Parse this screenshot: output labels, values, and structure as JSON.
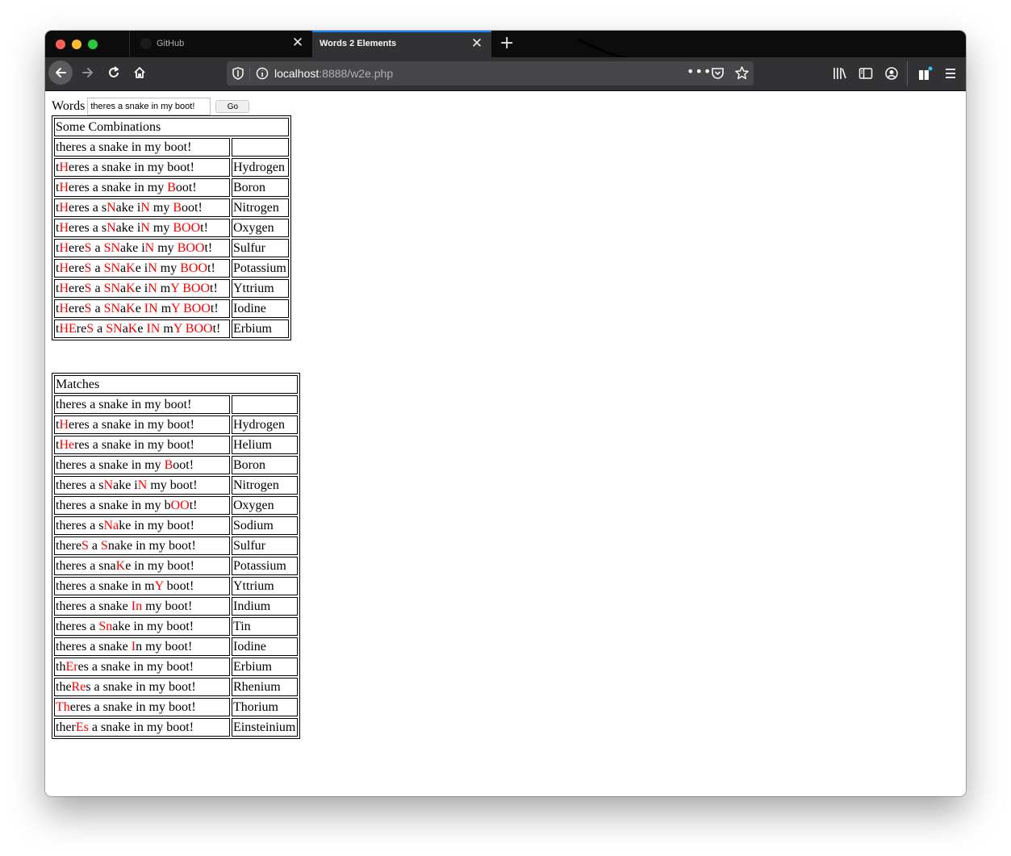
{
  "browser": {
    "tabs": [
      {
        "label": "GitHub",
        "active": false
      },
      {
        "label": "Words 2 Elements",
        "active": true
      }
    ],
    "url_host": "localhost",
    "url_rest": ":8888/w2e.php"
  },
  "form": {
    "label": "Words",
    "input_value": "theres a snake in my boot!",
    "button_label": "Go"
  },
  "colors": {
    "highlight": "#ff0000",
    "tab_accent": "#0a84ff"
  },
  "combinations": {
    "title": "Some Combinations",
    "rows": [
      {
        "segments": [
          [
            "theres a snake in my boot!",
            0
          ]
        ],
        "element": ""
      },
      {
        "segments": [
          [
            "t",
            0
          ],
          [
            "H",
            1
          ],
          [
            "eres a snake in my boot!",
            0
          ]
        ],
        "element": "Hydrogen"
      },
      {
        "segments": [
          [
            "t",
            0
          ],
          [
            "H",
            1
          ],
          [
            "eres a snake in my ",
            0
          ],
          [
            "B",
            1
          ],
          [
            "oot!",
            0
          ]
        ],
        "element": "Boron"
      },
      {
        "segments": [
          [
            "t",
            0
          ],
          [
            "H",
            1
          ],
          [
            "eres a s",
            0
          ],
          [
            "N",
            1
          ],
          [
            "ake i",
            0
          ],
          [
            "N",
            1
          ],
          [
            " my ",
            0
          ],
          [
            "B",
            1
          ],
          [
            "oot!",
            0
          ]
        ],
        "element": "Nitrogen"
      },
      {
        "segments": [
          [
            "t",
            0
          ],
          [
            "H",
            1
          ],
          [
            "eres a s",
            0
          ],
          [
            "N",
            1
          ],
          [
            "ake i",
            0
          ],
          [
            "N",
            1
          ],
          [
            " my ",
            0
          ],
          [
            "BOO",
            1
          ],
          [
            "t!",
            0
          ]
        ],
        "element": "Oxygen"
      },
      {
        "segments": [
          [
            "t",
            0
          ],
          [
            "H",
            1
          ],
          [
            "ere",
            0
          ],
          [
            "S",
            1
          ],
          [
            " a ",
            0
          ],
          [
            "SN",
            1
          ],
          [
            "ake i",
            0
          ],
          [
            "N",
            1
          ],
          [
            " my ",
            0
          ],
          [
            "BOO",
            1
          ],
          [
            "t!",
            0
          ]
        ],
        "element": "Sulfur"
      },
      {
        "segments": [
          [
            "t",
            0
          ],
          [
            "H",
            1
          ],
          [
            "ere",
            0
          ],
          [
            "S",
            1
          ],
          [
            " a ",
            0
          ],
          [
            "SN",
            1
          ],
          [
            "a",
            0
          ],
          [
            "K",
            1
          ],
          [
            "e i",
            0
          ],
          [
            "N",
            1
          ],
          [
            " my ",
            0
          ],
          [
            "BOO",
            1
          ],
          [
            "t!",
            0
          ]
        ],
        "element": "Potassium"
      },
      {
        "segments": [
          [
            "t",
            0
          ],
          [
            "H",
            1
          ],
          [
            "ere",
            0
          ],
          [
            "S",
            1
          ],
          [
            " a ",
            0
          ],
          [
            "SN",
            1
          ],
          [
            "a",
            0
          ],
          [
            "K",
            1
          ],
          [
            "e i",
            0
          ],
          [
            "N",
            1
          ],
          [
            " m",
            0
          ],
          [
            "Y",
            1
          ],
          [
            " ",
            0
          ],
          [
            "BOO",
            1
          ],
          [
            "t!",
            0
          ]
        ],
        "element": "Yttrium"
      },
      {
        "segments": [
          [
            "t",
            0
          ],
          [
            "H",
            1
          ],
          [
            "ere",
            0
          ],
          [
            "S",
            1
          ],
          [
            " a ",
            0
          ],
          [
            "SN",
            1
          ],
          [
            "a",
            0
          ],
          [
            "K",
            1
          ],
          [
            "e ",
            0
          ],
          [
            "IN",
            1
          ],
          [
            " m",
            0
          ],
          [
            "Y",
            1
          ],
          [
            " ",
            0
          ],
          [
            "BOO",
            1
          ],
          [
            "t!",
            0
          ]
        ],
        "element": "Iodine"
      },
      {
        "segments": [
          [
            "t",
            0
          ],
          [
            "HE",
            1
          ],
          [
            "re",
            0
          ],
          [
            "S",
            1
          ],
          [
            " a ",
            0
          ],
          [
            "SN",
            1
          ],
          [
            "a",
            0
          ],
          [
            "K",
            1
          ],
          [
            "e ",
            0
          ],
          [
            "IN",
            1
          ],
          [
            " m",
            0
          ],
          [
            "Y",
            1
          ],
          [
            " ",
            0
          ],
          [
            "BOO",
            1
          ],
          [
            "t!",
            0
          ]
        ],
        "element": "Erbium"
      }
    ]
  },
  "matches": {
    "title": "Matches",
    "rows": [
      {
        "segments": [
          [
            "theres a snake in my boot!",
            0
          ]
        ],
        "element": ""
      },
      {
        "segments": [
          [
            "t",
            0
          ],
          [
            "H",
            1
          ],
          [
            "eres a snake in my boot!",
            0
          ]
        ],
        "element": "Hydrogen"
      },
      {
        "segments": [
          [
            "t",
            0
          ],
          [
            "He",
            1
          ],
          [
            "res a snake in my boot!",
            0
          ]
        ],
        "element": "Helium"
      },
      {
        "segments": [
          [
            "theres a snake in my ",
            0
          ],
          [
            "B",
            1
          ],
          [
            "oot!",
            0
          ]
        ],
        "element": "Boron"
      },
      {
        "segments": [
          [
            "theres a s",
            0
          ],
          [
            "N",
            1
          ],
          [
            "ake i",
            0
          ],
          [
            "N",
            1
          ],
          [
            " my boot!",
            0
          ]
        ],
        "element": "Nitrogen"
      },
      {
        "segments": [
          [
            "theres a snake in my b",
            0
          ],
          [
            "OO",
            1
          ],
          [
            "t!",
            0
          ]
        ],
        "element": "Oxygen"
      },
      {
        "segments": [
          [
            "theres a s",
            0
          ],
          [
            "Na",
            1
          ],
          [
            "ke in my boot!",
            0
          ]
        ],
        "element": "Sodium"
      },
      {
        "segments": [
          [
            "there",
            0
          ],
          [
            "S",
            1
          ],
          [
            " a ",
            0
          ],
          [
            "S",
            1
          ],
          [
            "nake in my boot!",
            0
          ]
        ],
        "element": "Sulfur"
      },
      {
        "segments": [
          [
            "theres a sna",
            0
          ],
          [
            "K",
            1
          ],
          [
            "e in my boot!",
            0
          ]
        ],
        "element": "Potassium"
      },
      {
        "segments": [
          [
            "theres a snake in m",
            0
          ],
          [
            "Y",
            1
          ],
          [
            " boot!",
            0
          ]
        ],
        "element": "Yttrium"
      },
      {
        "segments": [
          [
            "theres a snake ",
            0
          ],
          [
            "In",
            1
          ],
          [
            " my boot!",
            0
          ]
        ],
        "element": "Indium"
      },
      {
        "segments": [
          [
            "theres a ",
            0
          ],
          [
            "Sn",
            1
          ],
          [
            "ake in my boot!",
            0
          ]
        ],
        "element": "Tin"
      },
      {
        "segments": [
          [
            "theres a snake ",
            0
          ],
          [
            "I",
            1
          ],
          [
            "n my boot!",
            0
          ]
        ],
        "element": "Iodine"
      },
      {
        "segments": [
          [
            "th",
            0
          ],
          [
            "Er",
            1
          ],
          [
            "es a snake in my boot!",
            0
          ]
        ],
        "element": "Erbium"
      },
      {
        "segments": [
          [
            "the",
            0
          ],
          [
            "Re",
            1
          ],
          [
            "s a snake in my boot!",
            0
          ]
        ],
        "element": "Rhenium"
      },
      {
        "segments": [
          [
            "Th",
            1
          ],
          [
            "eres a snake in my boot!",
            0
          ]
        ],
        "element": "Thorium"
      },
      {
        "segments": [
          [
            "ther",
            0
          ],
          [
            "Es",
            1
          ],
          [
            " a snake in my boot!",
            0
          ]
        ],
        "element": "Einsteinium"
      }
    ]
  }
}
